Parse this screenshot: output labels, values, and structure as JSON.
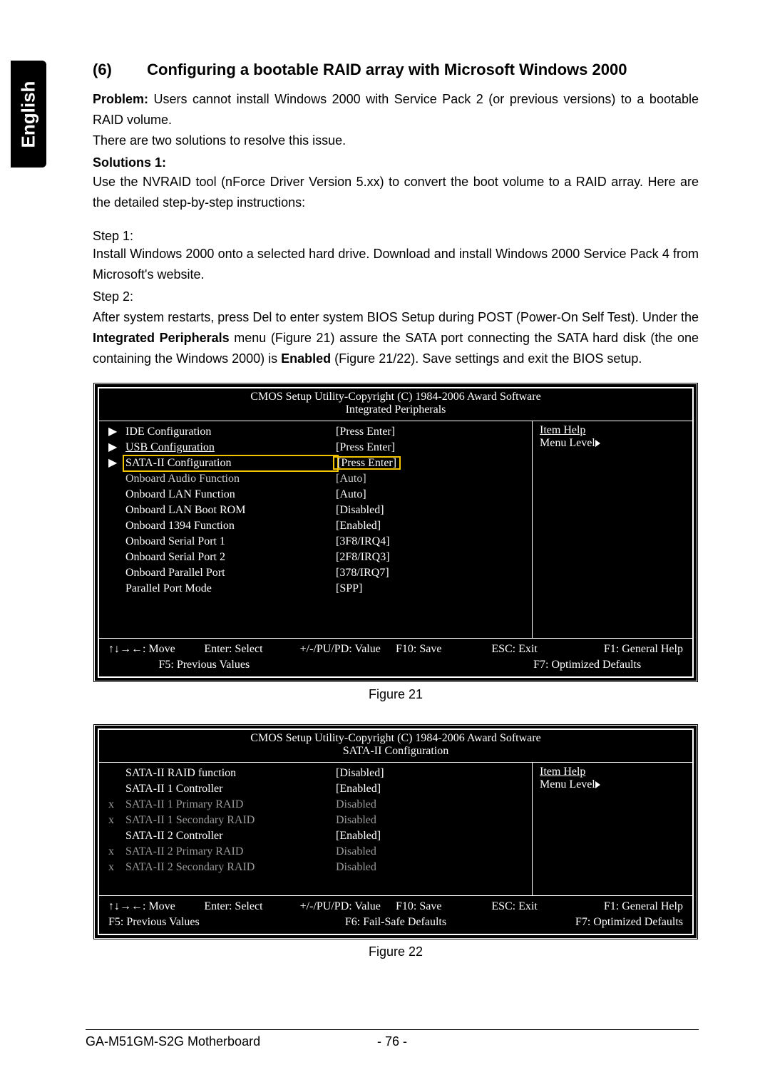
{
  "language_tab": "English",
  "section": {
    "number": "(6)",
    "title": "Configuring a bootable RAID array with Microsoft Windows 2000"
  },
  "para": {
    "problem_label": "Problem:",
    "problem_text": " Users cannot install Windows 2000 with Service Pack 2 (or previous versions) to a bootable RAID volume.",
    "resolve": "There are two solutions to resolve this issue.",
    "solutions1": "Solutions 1:",
    "sol1_text": "Use the NVRAID tool (nForce Driver Version 5.xx) to convert the boot volume to a RAID array. Here are the detailed step-by-step instructions:",
    "step1_label": "Step 1:",
    "step1_text": "Install Windows 2000 onto a selected hard drive. Download and install Windows 2000 Service Pack 4 from Microsoft's website.",
    "step2_label": "Step 2:",
    "step2_text_a": "After system restarts, press Del to enter system BIOS Setup during POST (Power-On Self Test). Under the ",
    "step2_bold1": "Integrated Peripherals",
    "step2_text_b": " menu (Figure 21) assure the SATA port connecting the SATA hard disk (the one containing the Windows 2000) is ",
    "step2_bold2": "Enabled",
    "step2_text_c": " (Figure 21/22). Save settings and exit the BIOS setup."
  },
  "bios1": {
    "copyright": "CMOS Setup Utility-Copyright (C) 1984-2006 Award Software",
    "subtitle": "Integrated Peripherals",
    "rows": [
      {
        "marker": "▶",
        "label": "IDE Configuration",
        "value": "[Press Enter]",
        "submenu": true
      },
      {
        "marker": "▶",
        "label": "USB Configuration",
        "value": "[Press Enter]",
        "submenu": true,
        "underline": true
      },
      {
        "marker": "▶",
        "label": "SATA-II Configuration",
        "value": "[Press Enter]",
        "submenu": true,
        "highlight": true
      },
      {
        "marker": "",
        "label": "Onboard Audio Function",
        "value": "[Auto]",
        "pale": true
      },
      {
        "marker": "",
        "label": "Onboard LAN Function",
        "value": "[Auto]"
      },
      {
        "marker": "",
        "label": "Onboard LAN Boot ROM",
        "value": "[Disabled]"
      },
      {
        "marker": "",
        "label": "Onboard 1394 Function",
        "value": "[Enabled]"
      },
      {
        "marker": "",
        "label": "Onboard Serial Port 1",
        "value": "[3F8/IRQ4]"
      },
      {
        "marker": "",
        "label": "Onboard Serial Port 2",
        "value": "[2F8/IRQ3]"
      },
      {
        "marker": "",
        "label": "Onboard Parallel Port",
        "value": "[378/IRQ7]"
      },
      {
        "marker": "",
        "label": "Parallel Port Mode",
        "value": "[SPP]"
      }
    ],
    "help_title": "Item Help",
    "help_menu": "Menu Level",
    "footer": {
      "r1c1": "↑↓→←: Move",
      "r1c2": "Enter: Select",
      "r1c3": "+/-/PU/PD: Value",
      "r1c4": "F10: Save",
      "r1c5": "ESC: Exit",
      "r1c6": "F1: General Help",
      "r2c1": "F5: Previous Values",
      "r2c2": "F7: Optimized Defaults"
    },
    "caption": "Figure 21"
  },
  "bios2": {
    "copyright": "CMOS Setup Utility-Copyright (C) 1984-2006 Award Software",
    "subtitle": "SATA-II Configuration",
    "rows": [
      {
        "marker": "",
        "label": "SATA-II RAID function",
        "value": "[Disabled]"
      },
      {
        "marker": "",
        "label": "SATA-II 1 Controller",
        "value": "[Enabled]"
      },
      {
        "marker": "x",
        "label": "SATA-II 1 Primary RAID",
        "value": "Disabled",
        "gray": true
      },
      {
        "marker": "x",
        "label": "SATA-II 1 Secondary RAID",
        "value": "Disabled",
        "gray": true
      },
      {
        "marker": "",
        "label": "SATA-II 2 Controller",
        "value": "[Enabled]"
      },
      {
        "marker": "x",
        "label": "SATA-II 2 Primary RAID",
        "value": "Disabled",
        "gray": true
      },
      {
        "marker": "x",
        "label": "SATA-II 2 Secondary RAID",
        "value": "Disabled",
        "gray": true
      }
    ],
    "help_title": "Item Help",
    "help_menu": "Menu Level",
    "footer": {
      "r1c1": "↑↓→←: Move",
      "r1c2": "Enter: Select",
      "r1c3": "+/-/PU/PD: Value",
      "r1c4": "F10: Save",
      "r1c5": "ESC: Exit",
      "r1c6": "F1: General Help",
      "r2c1": "F5: Previous Values",
      "r2c2": "F6: Fail-Safe Defaults",
      "r2c3": "F7: Optimized Defaults"
    },
    "caption": "Figure 22"
  },
  "footer": {
    "motherboard": "GA-M51GM-S2G Motherboard",
    "page": "- 76 -"
  }
}
